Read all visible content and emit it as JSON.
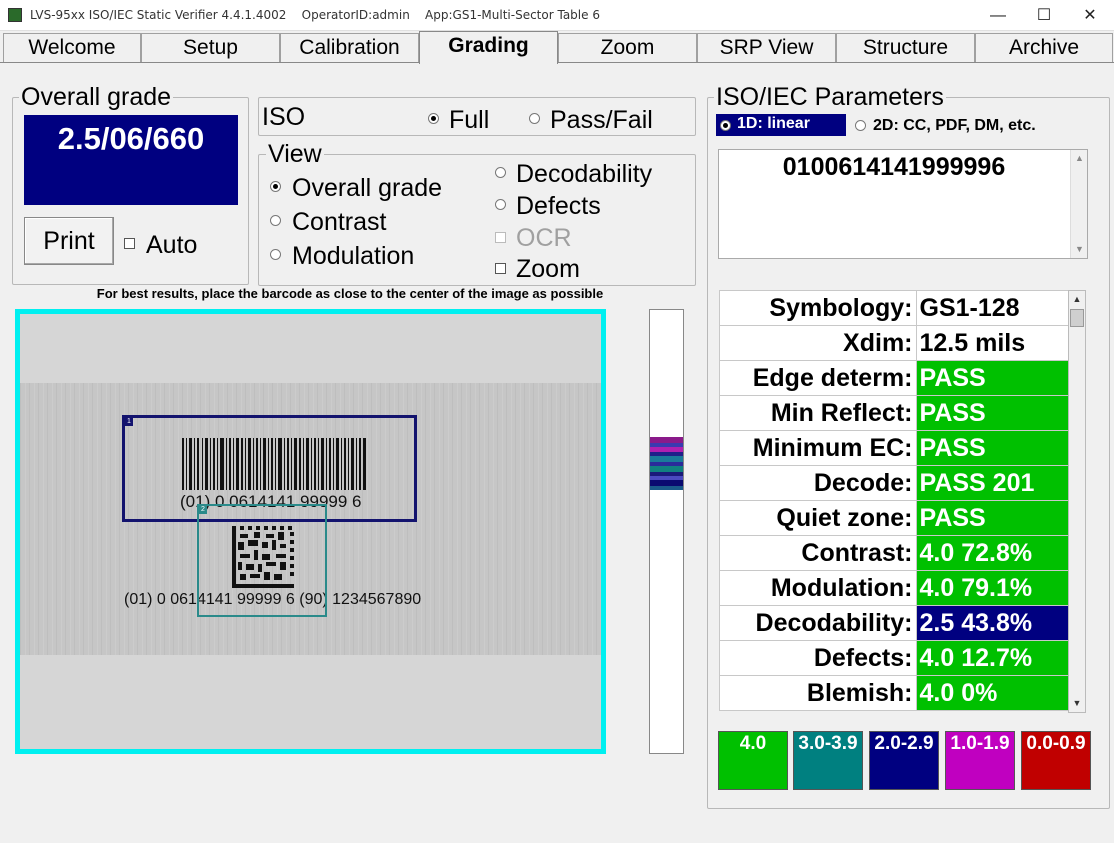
{
  "window": {
    "title": "LVS-95xx ISO/IEC Static Verifier 4.4.1.4002    OperatorID:admin    App:GS1-Multi-Sector Table 6",
    "minimize": "—",
    "maximize": "☐",
    "close": "✕"
  },
  "tabs": [
    {
      "label": "Welcome"
    },
    {
      "label": "Setup"
    },
    {
      "label": "Calibration"
    },
    {
      "label": "Grading"
    },
    {
      "label": "Zoom"
    },
    {
      "label": "SRP View"
    },
    {
      "label": "Structure"
    },
    {
      "label": "Archive"
    }
  ],
  "active_tab": "Grading",
  "overall": {
    "legend": "Overall grade",
    "grade": "2.5/06/660",
    "print_label": "Print",
    "auto_label": "Auto",
    "auto_checked": false
  },
  "iso": {
    "label": "ISO",
    "full_label": "Full",
    "passfail_label": "Pass/Fail",
    "selected": "Full"
  },
  "view": {
    "legend": "View",
    "overall_label": "Overall grade",
    "contrast_label": "Contrast",
    "modulation_label": "Modulation",
    "decodability_label": "Decodability",
    "defects_label": "Defects",
    "ocr_label": "OCR",
    "zoom_label": "Zoom",
    "selected": "Overall grade"
  },
  "hint": "For best results, place the barcode as close to the center of the image as possible",
  "image": {
    "roi1_num": "1",
    "roi2_num": "2",
    "hr_linear": "(01) 0 0614141 99999 6",
    "hr_2d": "(01) 0 0614141 99999 6 (90) 1234567890"
  },
  "params": {
    "legend": "ISO/IEC Parameters",
    "mode_1d": "1D: linear",
    "mode_2d": "2D: CC, PDF, DM, etc.",
    "selected_mode": "1D: linear",
    "decoded_data": "0100614141999996",
    "rows": [
      {
        "key": "Symbology:",
        "value": "GS1-128",
        "grade": "none"
      },
      {
        "key": "Xdim:",
        "value": "12.5 mils",
        "grade": "none"
      },
      {
        "key": "Edge determ:",
        "value": "PASS",
        "grade": "4.0"
      },
      {
        "key": "Min Reflect:",
        "value": "PASS",
        "grade": "4.0"
      },
      {
        "key": "Minimum EC:",
        "value": "PASS",
        "grade": "4.0"
      },
      {
        "key": "Decode:",
        "value": "PASS 201",
        "grade": "4.0"
      },
      {
        "key": "Quiet zone:",
        "value": "PASS",
        "grade": "4.0"
      },
      {
        "key": "Contrast:",
        "value": "4.0  72.8%",
        "grade": "4.0"
      },
      {
        "key": "Modulation:",
        "value": "4.0  79.1%",
        "grade": "4.0"
      },
      {
        "key": "Decodability:",
        "value": "2.5  43.8%",
        "grade": "2.0-2.9"
      },
      {
        "key": "Defects:",
        "value": "4.0  12.7%",
        "grade": "4.0"
      },
      {
        "key": "Blemish:",
        "value": "4.0  0%",
        "grade": "4.0"
      }
    ]
  },
  "grade_legend": [
    {
      "label": "4.0",
      "color": "#00c000"
    },
    {
      "label": "3.0-3.9",
      "color": "#008080"
    },
    {
      "label": "2.0-2.9",
      "color": "#000080"
    },
    {
      "label": "1.0-1.9",
      "color": "#c000c0"
    },
    {
      "label": "0.0-0.9",
      "color": "#c00000"
    }
  ],
  "colors": {
    "accent_cyan": "#00f0f0",
    "grade_box": "#000080"
  }
}
